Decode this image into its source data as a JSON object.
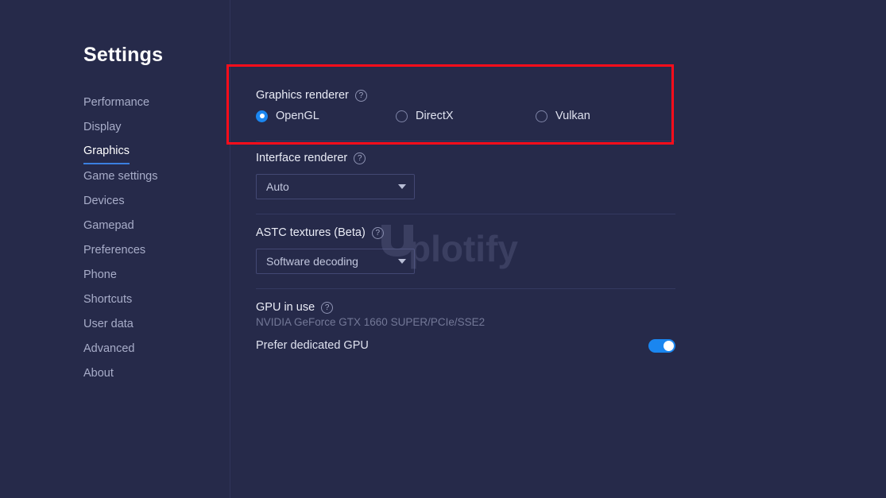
{
  "window": {
    "background_color": "#262a4a",
    "accent_color": "#1a86f0",
    "highlight_color": "#fc0d1b"
  },
  "sidebar": {
    "title": "Settings",
    "items": [
      {
        "label": "Performance",
        "active": false
      },
      {
        "label": "Display",
        "active": false
      },
      {
        "label": "Graphics",
        "active": true
      },
      {
        "label": "Game settings",
        "active": false
      },
      {
        "label": "Devices",
        "active": false
      },
      {
        "label": "Gamepad",
        "active": false
      },
      {
        "label": "Preferences",
        "active": false
      },
      {
        "label": "Phone",
        "active": false
      },
      {
        "label": "Shortcuts",
        "active": false
      },
      {
        "label": "User data",
        "active": false
      },
      {
        "label": "Advanced",
        "active": false
      },
      {
        "label": "About",
        "active": false
      }
    ]
  },
  "main": {
    "graphics_renderer": {
      "label": "Graphics renderer",
      "help_glyph": "?",
      "options": [
        {
          "label": "OpenGL",
          "selected": true
        },
        {
          "label": "DirectX",
          "selected": false
        },
        {
          "label": "Vulkan",
          "selected": false
        }
      ]
    },
    "interface_renderer": {
      "label": "Interface renderer",
      "help_glyph": "?",
      "value": "Auto"
    },
    "astc_textures": {
      "label": "ASTC textures (Beta)",
      "help_glyph": "?",
      "value": "Software decoding"
    },
    "gpu_in_use": {
      "label": "GPU in use",
      "help_glyph": "?",
      "device": "NVIDIA GeForce GTX 1660 SUPER/PCIe/SSE2",
      "prefer_dedicated_label": "Prefer dedicated GPU",
      "prefer_dedicated_on": true
    }
  },
  "watermark": {
    "text": "plotify"
  }
}
